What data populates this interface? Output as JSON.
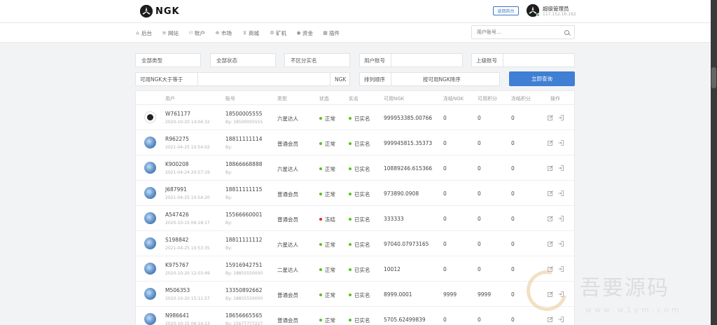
{
  "header": {
    "logo_text": "NGK",
    "back_label": "返回前台",
    "admin_name": "超级管理员",
    "admin_ip": "117.152.16.162"
  },
  "nav": [
    {
      "icon": "home-icon",
      "glyph": "⌂",
      "label": "后台"
    },
    {
      "icon": "list-icon",
      "glyph": "≡",
      "label": "网站"
    },
    {
      "icon": "users-icon",
      "glyph": "⚇",
      "label": "账户"
    },
    {
      "icon": "globe-icon",
      "glyph": "⊕",
      "label": "市场"
    },
    {
      "icon": "cart-icon",
      "glyph": "⊻",
      "label": "商城"
    },
    {
      "icon": "mining-icon",
      "glyph": "⚙",
      "label": "矿机"
    },
    {
      "icon": "coin-icon",
      "glyph": "◉",
      "label": "资金"
    },
    {
      "icon": "plugin-icon",
      "glyph": "▦",
      "label": "插件"
    }
  ],
  "search": {
    "placeholder": "用户账号..."
  },
  "filters": {
    "type": "全部类型",
    "status": "全部状态",
    "realname": "不区分实名",
    "user_account_label": "用户账号",
    "parent_account_label": "上级账号",
    "ngk_gte_label": "可用NGK大于等于",
    "ngk_unit": "NGK",
    "sort_label": "排列顺序",
    "sort_value": "按可用NGK降序",
    "query_button": "立即查询"
  },
  "table": {
    "headers": [
      "用户",
      "账号",
      "类型",
      "状态",
      "实名",
      "可用NGK",
      "冻结NGK",
      "可用积分",
      "冻结积分",
      "操作"
    ],
    "rows": [
      {
        "user": "W761177",
        "time": "2020-10-20 14:04:32",
        "phone": "18500005555",
        "by": "By: 18500005555",
        "type": "六星达人",
        "status": "正常",
        "status_color": "#52c41a",
        "realname": "已实名",
        "ngk": "999953385.00766",
        "frozen_ngk": "0",
        "points": "0",
        "frozen_points": "0",
        "avatar": "logo"
      },
      {
        "user": "R962275",
        "time": "2021-04-25 10:54:02",
        "phone": "18811111114",
        "by": "By:",
        "type": "普通会员",
        "status": "正常",
        "status_color": "#52c41a",
        "realname": "已实名",
        "ngk": "999945815.35373",
        "frozen_ngk": "0",
        "points": "0",
        "frozen_points": "0",
        "avatar": "earth"
      },
      {
        "user": "K900208",
        "time": "2021-04-24 20:57:19",
        "phone": "18866668888",
        "by": "By:",
        "type": "六星达人",
        "status": "正常",
        "status_color": "#52c41a",
        "realname": "已实名",
        "ngk": "10889246.615366",
        "frozen_ngk": "0",
        "points": "0",
        "frozen_points": "0",
        "avatar": "earth"
      },
      {
        "user": "J687991",
        "time": "2021-04-25 10:54:20",
        "phone": "18811111115",
        "by": "By:",
        "type": "普通会员",
        "status": "正常",
        "status_color": "#52c41a",
        "realname": "已实名",
        "ngk": "973890.0908",
        "frozen_ngk": "0",
        "points": "0",
        "frozen_points": "0",
        "avatar": "earth"
      },
      {
        "user": "A547426",
        "time": "2020-10-15 06:18:17",
        "phone": "15566660001",
        "by": "By:",
        "type": "普通会员",
        "status": "冻结",
        "status_color": "#d9301f",
        "realname": "已实名",
        "ngk": "333333",
        "frozen_ngk": "0",
        "points": "0",
        "frozen_points": "0",
        "avatar": "earth"
      },
      {
        "user": "S198842",
        "time": "2021-04-25 10:53:35",
        "phone": "18811111112",
        "by": "By:",
        "type": "六星达人",
        "status": "正常",
        "status_color": "#52c41a",
        "realname": "已实名",
        "ngk": "97040.07973165",
        "frozen_ngk": "0",
        "points": "0",
        "frozen_points": "0",
        "avatar": "earth"
      },
      {
        "user": "K975767",
        "time": "2020-10-20 12:03:49",
        "phone": "15916942751",
        "by": "By: 18855550000",
        "type": "二星达人",
        "status": "正常",
        "status_color": "#52c41a",
        "realname": "已实名",
        "ngk": "10012",
        "frozen_ngk": "0",
        "points": "0",
        "frozen_points": "0",
        "avatar": "earth"
      },
      {
        "user": "M506353",
        "time": "2020-10-20 15:11:57",
        "phone": "13350892662",
        "by": "By: 18855550000",
        "type": "普通会员",
        "status": "正常",
        "status_color": "#52c41a",
        "realname": "已实名",
        "ngk": "8999.0001",
        "frozen_ngk": "9999",
        "points": "9999",
        "frozen_points": "0",
        "avatar": "earth"
      },
      {
        "user": "N986641",
        "time": "2020-10-15 06:14:13",
        "phone": "18656665565",
        "by": "By: 15677777227",
        "type": "普通会员",
        "status": "正常",
        "status_color": "#52c41a",
        "realname": "已实名",
        "ngk": "5705.62499839",
        "frozen_ngk": "0",
        "points": "0",
        "frozen_points": "0",
        "avatar": "earth"
      }
    ]
  },
  "watermark": {
    "text": "吾要源码",
    "url": "www.w1ym.com"
  }
}
